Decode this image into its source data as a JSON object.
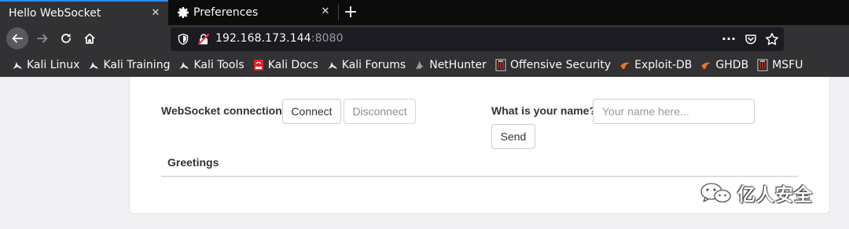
{
  "tabs": [
    {
      "title": "Hello WebSocket",
      "active": true
    },
    {
      "title": "Preferences",
      "icon": "gear-icon",
      "active": false
    }
  ],
  "navbar": {
    "url_host": "192.168.173.144",
    "url_port": ":8080"
  },
  "bookmarks": [
    {
      "label": "Kali Linux",
      "icon": "kali-dragon-icon"
    },
    {
      "label": "Kali Training",
      "icon": "kali-dragon-icon"
    },
    {
      "label": "Kali Tools",
      "icon": "kali-dragon-icon"
    },
    {
      "label": "Kali Docs",
      "icon": "kali-docs-icon"
    },
    {
      "label": "Kali Forums",
      "icon": "kali-dragon-icon"
    },
    {
      "label": "NetHunter",
      "icon": "nethunter-icon"
    },
    {
      "label": "Offensive Security",
      "icon": "offsec-icon"
    },
    {
      "label": "Exploit-DB",
      "icon": "exploitdb-icon"
    },
    {
      "label": "GHDB",
      "icon": "exploitdb-icon"
    },
    {
      "label": "MSFU",
      "icon": "offsec-icon"
    }
  ],
  "app": {
    "connection_label": "WebSocket connection:",
    "connect_label": "Connect",
    "disconnect_label": "Disconnect",
    "name_label": "What is your name?",
    "name_placeholder": "Your name here...",
    "name_value": "",
    "send_label": "Send",
    "greetings_header": "Greetings"
  },
  "watermark": {
    "text": "亿人安全"
  },
  "colors": {
    "tab_accent": "#2d8cff",
    "chrome_dark": "#0c0c0d",
    "chrome_mid": "#323234",
    "urlbar_bg": "#1c1b22"
  }
}
